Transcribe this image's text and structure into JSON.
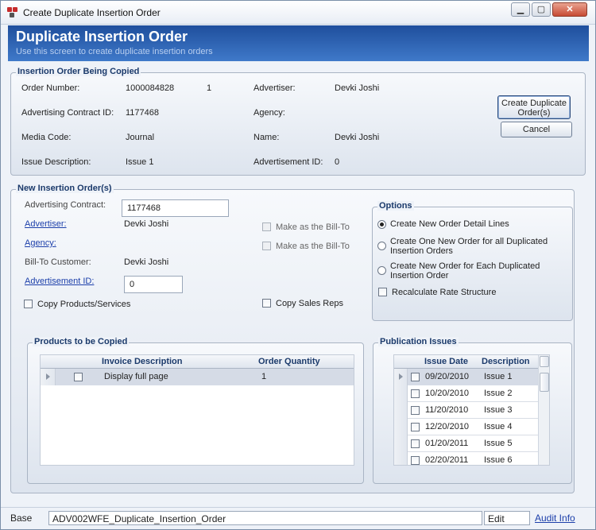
{
  "window": {
    "title": "Create Duplicate Insertion Order"
  },
  "header": {
    "title": "Duplicate Insertion Order",
    "subtitle": "Use this screen to create duplicate insertion orders"
  },
  "original": {
    "section_title": "Insertion Order Being Copied",
    "order_number_label": "Order Number:",
    "order_number": "1000084828",
    "order_line": "1",
    "advertiser_label": "Advertiser:",
    "advertiser": "Devki Joshi",
    "contract_label": "Advertising Contract ID:",
    "contract": "1177468",
    "agency_label": "Agency:",
    "media_label": "Media Code:",
    "media": "Journal",
    "name_label": "Name:",
    "name": "Devki Joshi",
    "issue_desc_label": "Issue Description:",
    "issue_desc": "Issue 1",
    "ad_id_label": "Advertisement ID:",
    "ad_id": "0",
    "create_button": "Create Duplicate Order(s)",
    "cancel_button": "Cancel"
  },
  "new_order": {
    "section_title": "New Insertion Order(s)",
    "contract_label": "Advertising Contract:",
    "contract_value": "1177468",
    "advertiser_label": "Advertiser:",
    "advertiser": "Devki Joshi",
    "agency_label": "Agency:",
    "bill_to_label": "Bill-To Customer:",
    "bill_to": "Devki Joshi",
    "ad_id_label": "Advertisement ID:",
    "ad_id_value": "0",
    "make_bill_to_1": "Make as the Bill-To",
    "make_bill_to_2": "Make as the Bill-To",
    "copy_products": "Copy Products/Services",
    "copy_sales_reps": "Copy Sales Reps"
  },
  "options": {
    "title": "Options",
    "opt1": "Create New Order Detail Lines",
    "opt2": "Create One New Order for all Duplicated Insertion Orders",
    "opt3": "Create New Order for Each Duplicated Insertion Order",
    "recalc": "Recalculate Rate Structure"
  },
  "products": {
    "title": "Products to be Copied",
    "col_desc": "Invoice Description",
    "col_qty": "Order Quantity",
    "rows": [
      {
        "desc": "Display full page",
        "qty": "1"
      }
    ]
  },
  "issues": {
    "title": "Publication Issues",
    "col_date": "Issue Date",
    "col_desc": "Description",
    "rows": [
      {
        "date": "09/20/2010",
        "desc": "Issue 1"
      },
      {
        "date": "10/20/2010",
        "desc": "Issue 2"
      },
      {
        "date": "11/20/2010",
        "desc": "Issue 3"
      },
      {
        "date": "12/20/2010",
        "desc": "Issue 4"
      },
      {
        "date": "01/20/2011",
        "desc": "Issue 5"
      },
      {
        "date": "02/20/2011",
        "desc": "Issue 6"
      }
    ]
  },
  "status": {
    "mode": "Base",
    "form_id": "ADV002WFE_Duplicate_Insertion_Order",
    "state": "Edit",
    "audit": "Audit Info"
  }
}
